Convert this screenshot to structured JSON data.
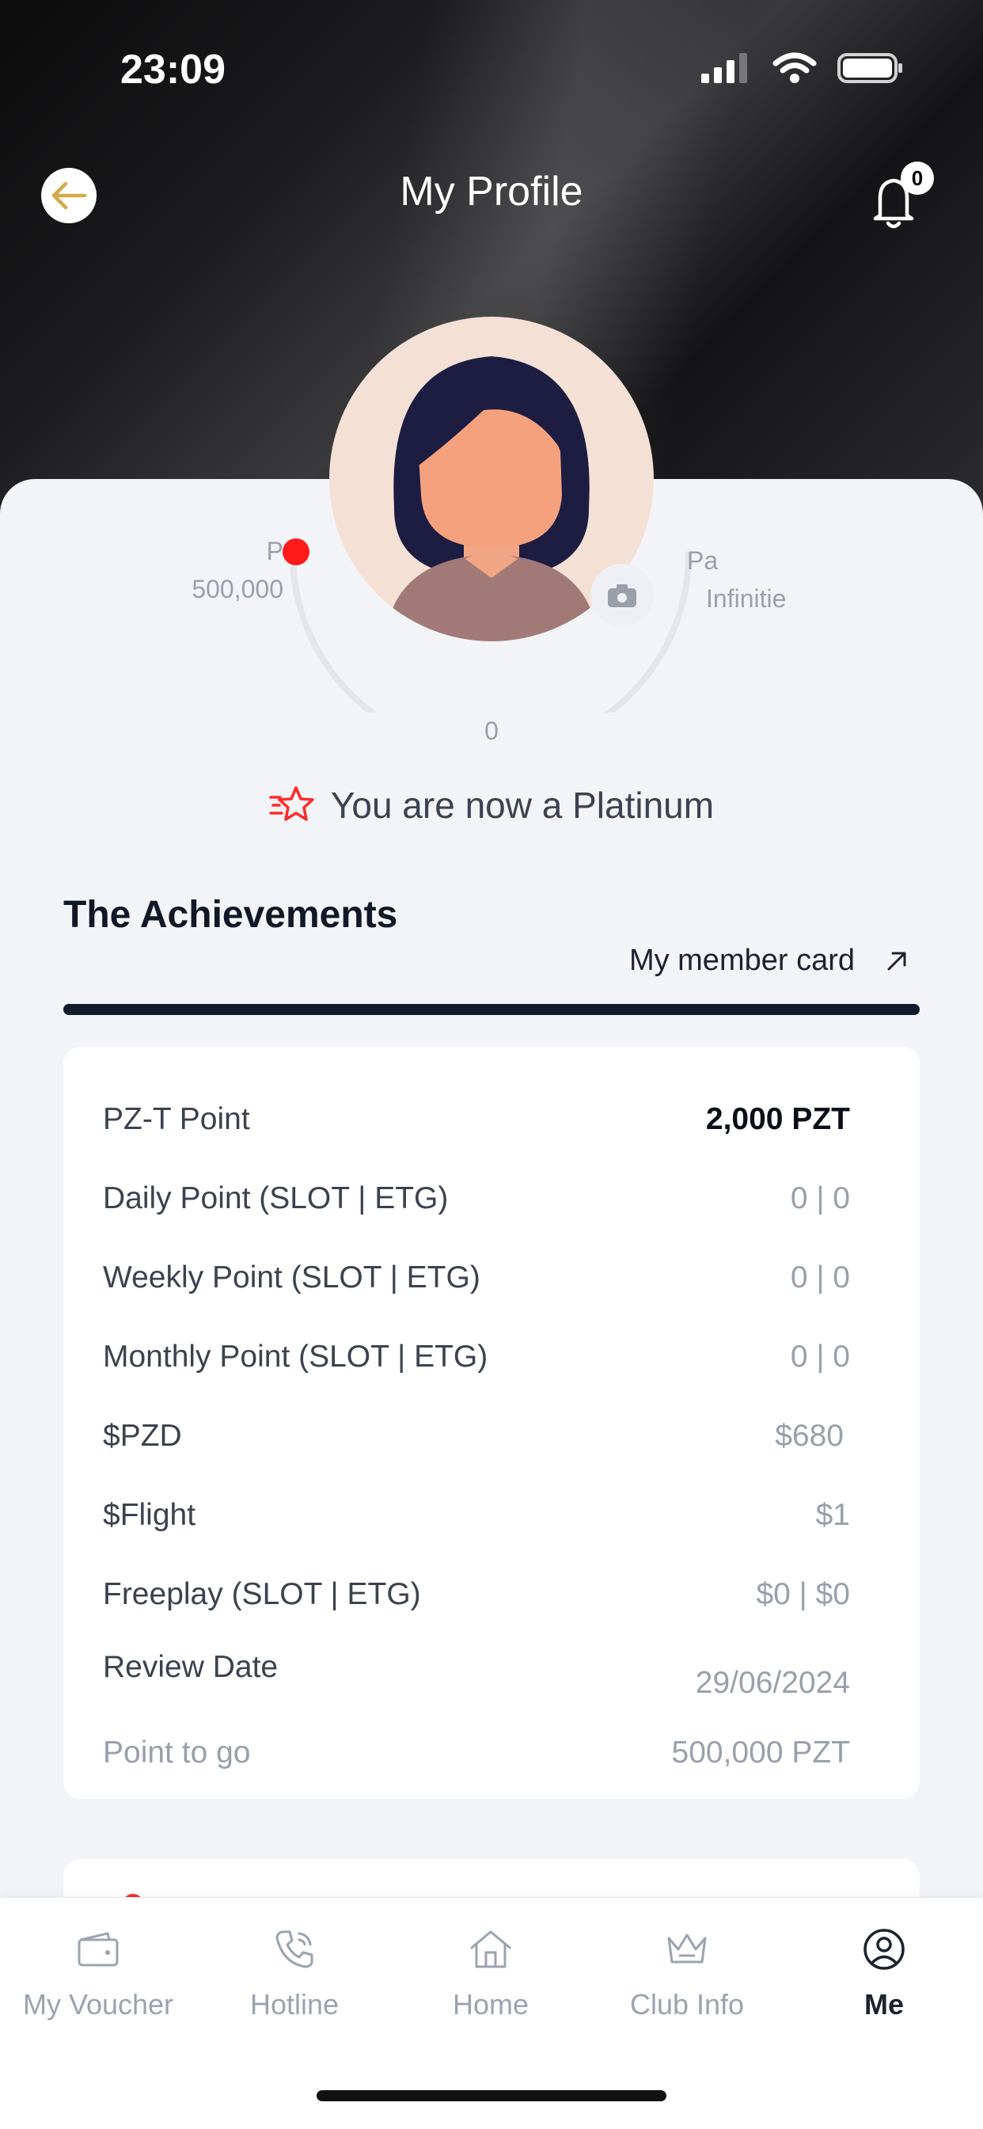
{
  "status": {
    "time": "23:09"
  },
  "header": {
    "title": "My Profile",
    "notification_count": "0"
  },
  "profile": {
    "left_tier_short": "P",
    "left_points": "500,000",
    "right_tier_short": "Pa",
    "right_points": "Infinitie",
    "current_points": "0",
    "tier_message": "You are now a Platinum",
    "progress_fraction": 0.0
  },
  "achievements": {
    "title": "The Achievements",
    "member_card_label": "My member card",
    "rows": [
      {
        "label": "PZ-T Point",
        "value": "2,000 PZT"
      },
      {
        "label": "Daily Point (SLOT | ETG)",
        "value": "0 | 0"
      },
      {
        "label": "Weekly Point (SLOT | ETG)",
        "value": "0 | 0"
      },
      {
        "label": "Monthly Point (SLOT | ETG)",
        "value": "0 | 0"
      },
      {
        "label": "$PZD",
        "value": "$680"
      },
      {
        "label": "$Flight",
        "value": "$1"
      },
      {
        "label": "Freeplay (SLOT | ETG)",
        "value": "$0 | $0"
      },
      {
        "label": "Review Date",
        "value": "29/06/2024"
      },
      {
        "label": "Point to go",
        "value": "500,000 PZT"
      }
    ]
  },
  "tabbar": {
    "items": [
      {
        "label": "My Voucher"
      },
      {
        "label": "Hotline"
      },
      {
        "label": "Home"
      },
      {
        "label": "Club Info"
      },
      {
        "label": "Me"
      }
    ]
  },
  "colors": {
    "accent_red": "#ff1a1a",
    "back_arrow": "#d4a94a",
    "dark": "#111b2b"
  }
}
